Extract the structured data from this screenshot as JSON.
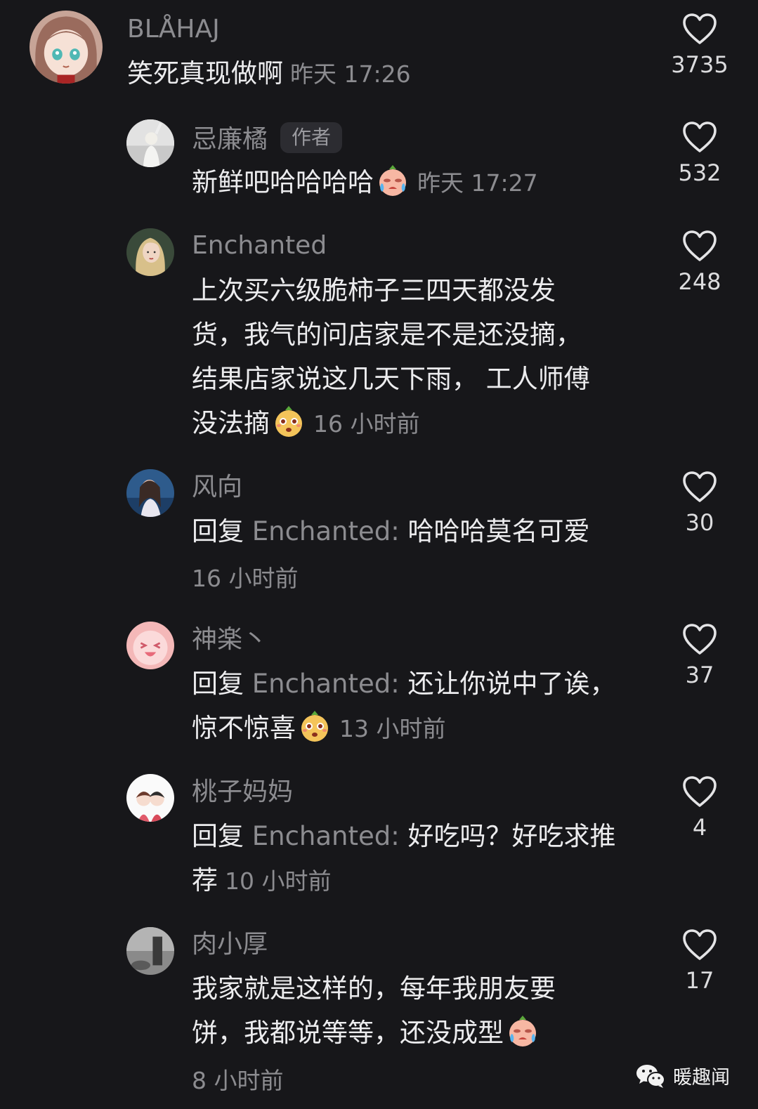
{
  "comments": [
    {
      "username": "BLÅHAJ",
      "text": "笑死真现做啊",
      "time": "昨天 17:26",
      "likes": "3735",
      "avatar_icon": "anime-girl-avatar"
    },
    {
      "username": "忌廉橘",
      "author_tag": "作者",
      "text": "新鲜吧哈哈哈哈",
      "emoji": "crying-face-emoji",
      "time": "昨天 17:27",
      "likes": "532",
      "avatar_icon": "person-photo-avatar"
    },
    {
      "username": "Enchanted",
      "lines": [
        "上次买六级脆柿子三四天都没发",
        "货，我气的问店家是不是还没摘，",
        "结果店家说这几天下雨， 工人师傅",
        "没法摘"
      ],
      "emoji": "surprised-face-emoji",
      "time": "16 小时前",
      "likes": "248",
      "avatar_icon": "blonde-woman-avatar"
    },
    {
      "username": "风向",
      "reply_prefix": "回复",
      "reply_target": "Enchanted:",
      "text": "哈哈哈莫名可爱",
      "time": "16 小时前",
      "likes": "30",
      "avatar_icon": "ocean-portrait-avatar"
    },
    {
      "username": "神楽丶",
      "reply_prefix": "回复",
      "reply_target": "Enchanted:",
      "text": "还让你说中了诶，",
      "line2": "惊不惊喜",
      "emoji": "surprised-face-emoji",
      "time": "13 小时前",
      "likes": "37",
      "avatar_icon": "pink-laughing-avatar"
    },
    {
      "username": "桃子妈妈",
      "reply_prefix": "回复",
      "reply_target": "Enchanted:",
      "text": "好吃吗？好吃求推",
      "line2": "荐",
      "time": "10 小时前",
      "likes": "4",
      "avatar_icon": "cartoon-couple-avatar"
    },
    {
      "username": "肉小厚",
      "lines": [
        "我家就是这样的，每年我朋友要",
        "饼，我都说等等，还没成型"
      ],
      "emoji": "crying-face-emoji",
      "time": "8 小时前",
      "likes": "17",
      "avatar_icon": "grayscale-photo-avatar"
    }
  ],
  "watermark": {
    "text": "暖趣闻",
    "icon": "wechat-icon"
  },
  "colors": {
    "background": "#17171a",
    "primary_text": "#ececee",
    "secondary_text": "#8c8c90"
  }
}
